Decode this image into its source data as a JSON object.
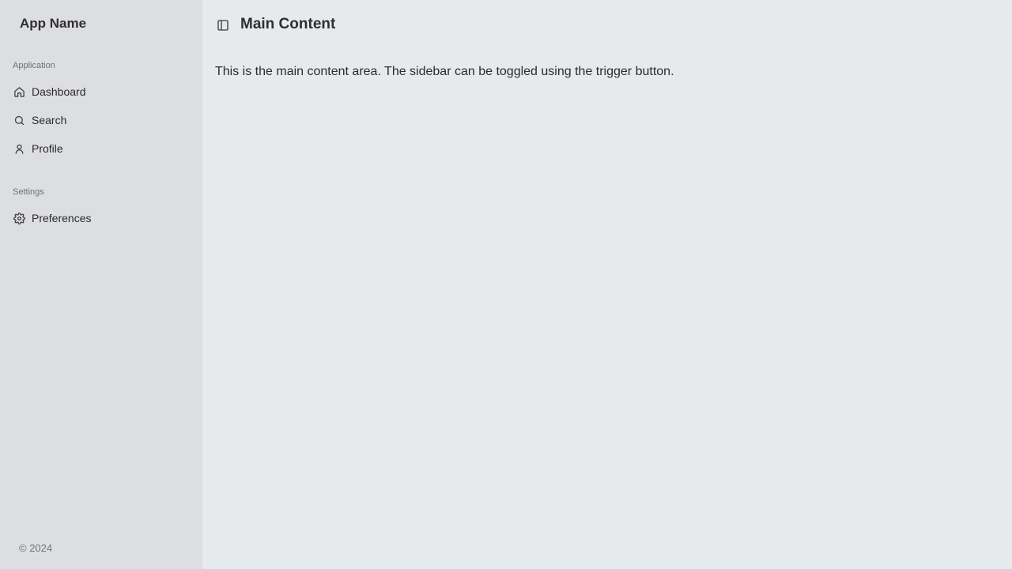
{
  "sidebar": {
    "app_name": "App Name",
    "groups": [
      {
        "label": "Application",
        "items": [
          {
            "label": "Dashboard",
            "icon": "home-icon"
          },
          {
            "label": "Search",
            "icon": "search-icon"
          },
          {
            "label": "Profile",
            "icon": "user-icon"
          }
        ]
      },
      {
        "label": "Settings",
        "items": [
          {
            "label": "Preferences",
            "icon": "gear-icon"
          }
        ]
      }
    ],
    "footer": "© 2024"
  },
  "main": {
    "toggle_icon": "sidebar-toggle-icon",
    "title": "Main Content",
    "body": "This is the main content area. The sidebar can be toggled using the trigger button."
  },
  "colors": {
    "sidebar_bg": "#dddee2",
    "main_bg": "#e6eaed",
    "text": "#2b2b2e",
    "muted": "#6f7076"
  }
}
